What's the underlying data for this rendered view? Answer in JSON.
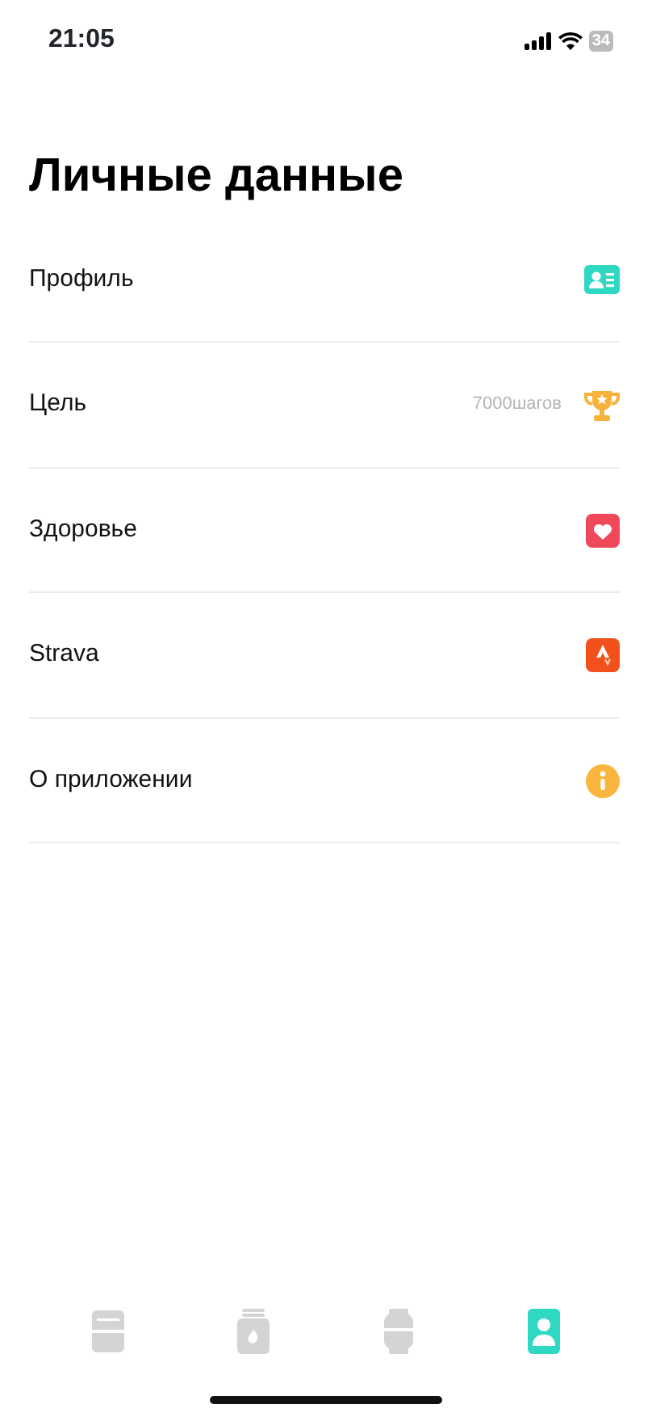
{
  "status_bar": {
    "time": "21:05",
    "battery": "34"
  },
  "title": "Личные данные",
  "items": [
    {
      "kind": "profile",
      "label": "Профиль"
    },
    {
      "kind": "goal",
      "label": "Цель",
      "value": "7000шагов"
    },
    {
      "kind": "health",
      "label": "Здоровье"
    },
    {
      "kind": "strava",
      "label": "Strava"
    },
    {
      "kind": "info",
      "label": "О приложении"
    }
  ],
  "tab_bar": [
    {
      "kind": "cards",
      "selected": false
    },
    {
      "kind": "jar",
      "selected": false
    },
    {
      "kind": "watch",
      "selected": false
    },
    {
      "kind": "person",
      "selected": true
    }
  ]
}
